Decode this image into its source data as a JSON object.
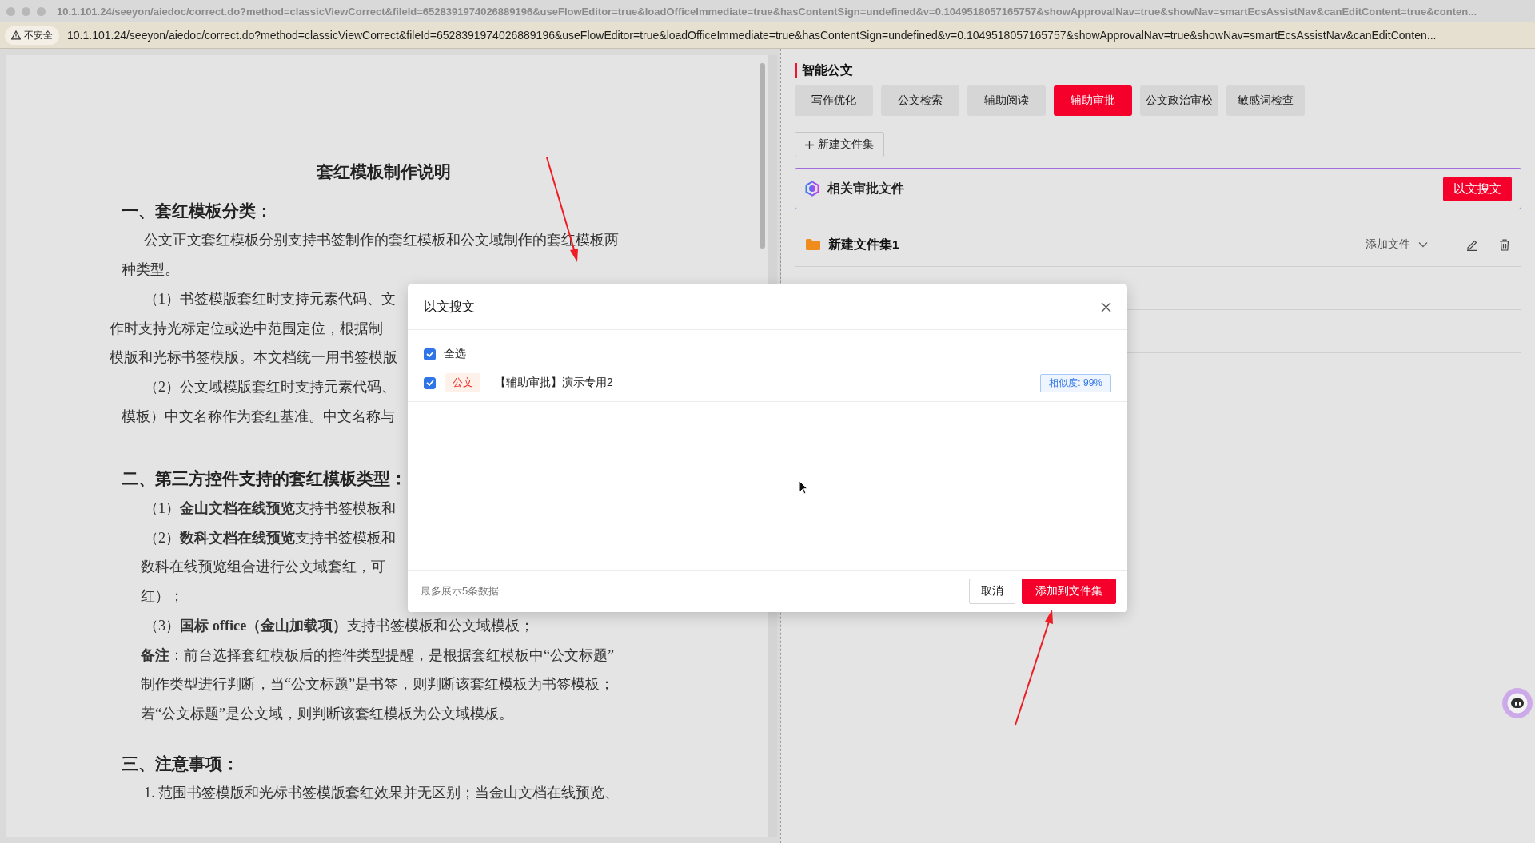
{
  "browser": {
    "title_url": "10.1.101.24/seeyon/aiedoc/correct.do?method=classicViewCorrect&fileId=6528391974026889196&useFlowEditor=true&loadOfficeImmediate=true&hasContentSign=undefined&v=0.1049518057165757&showApprovalNav=true&showNav=smartEcsAssistNav&canEditContent=true&conten...",
    "security_badge": "不安全",
    "address": "10.1.101.24/seeyon/aiedoc/correct.do?method=classicViewCorrect&fileId=6528391974026889196&useFlowEditor=true&loadOfficeImmediate=true&hasContentSign=undefined&v=0.1049518057165757&showApprovalNav=true&showNav=smartEcsAssistNav&canEditConten..."
  },
  "document": {
    "lines": [
      {
        "kind": "title",
        "text": "套红模板制作说明"
      },
      {
        "kind": "heading",
        "text": "一、套红模板分类："
      },
      {
        "kind": "para",
        "text": "公文正文套红模板分别支持书签制作的套红模板和公文域制作的套红模板两"
      },
      {
        "kind": "cont",
        "text": "种类型。"
      },
      {
        "kind": "para",
        "text": "（1）书签模版套红时支持元素代码、文"
      },
      {
        "kind": "outdent",
        "text": "作时支持光标定位或选中范围定位，根据制"
      },
      {
        "kind": "outdent",
        "text": "模版和光标书签模版。本文档统一用书签模版"
      },
      {
        "kind": "para",
        "text": "（2）公文域模版套红时支持元素代码、"
      },
      {
        "kind": "cont",
        "text": "模板）中文名称作为套红基准。中文名称与"
      },
      {
        "kind": "heading",
        "text": "二、第三方控件支持的套红模板类型："
      },
      {
        "kind": "para",
        "text": "（1）**金山文档在线预览**支持书签模板和"
      },
      {
        "kind": "para",
        "text": "（2）**数科文档在线预览**支持书签模板和"
      },
      {
        "kind": "body",
        "text": "数科在线预览组合进行公文域套红，可"
      },
      {
        "kind": "body",
        "text": "红）；"
      },
      {
        "kind": "para",
        "text": "（3）**国标 office（金山加载项）**支持书签模板和公文域模板；"
      },
      {
        "kind": "body",
        "text": "**备注**：前台选择套红模板后的控件类型提醒，是根据套红模板中“公文标题”"
      },
      {
        "kind": "body",
        "text": "制作类型进行判断，当“公文标题”是书签，则判断该套红模板为书签模板；"
      },
      {
        "kind": "body",
        "text": "若“公文标题”是公文域，则判断该套红模板为公文域模板。"
      },
      {
        "kind": "heading",
        "text": "三、注意事项："
      },
      {
        "kind": "para",
        "text": "1. 范围书签模版和光标书签模版套红效果并无区别；当金山文档在线预览、"
      }
    ]
  },
  "panel": {
    "title": "智能公文",
    "tabs": [
      {
        "label": "写作优化",
        "selected": false
      },
      {
        "label": "公文检索",
        "selected": false
      },
      {
        "label": "辅助阅读",
        "selected": false
      },
      {
        "label": "辅助审批",
        "selected": true
      },
      {
        "label": "公文政治审校",
        "selected": false
      },
      {
        "label": "敏感词检查",
        "selected": false
      }
    ],
    "new_set_button": "新建文件集",
    "ai_card": {
      "title": "相关审批文件",
      "button": "以文搜文"
    },
    "folder": {
      "name": "新建文件集1",
      "add_file": "添加文件"
    }
  },
  "dialog": {
    "title": "以文搜文",
    "select_all": {
      "label": "全选",
      "checked": true
    },
    "results": [
      {
        "checked": true,
        "tag": "公文",
        "title": "【辅助审批】演示专用2",
        "similarity": "相似度: 99%"
      }
    ],
    "footer_note": "最多展示5条数据",
    "buttons": [
      {
        "label": "取消",
        "kind": "secondary"
      },
      {
        "label": "添加到文件集",
        "kind": "primary"
      }
    ]
  }
}
